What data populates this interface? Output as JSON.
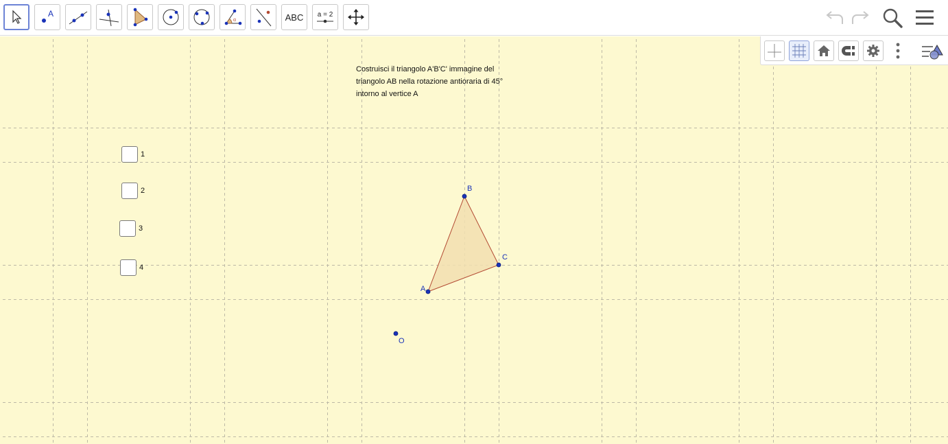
{
  "toolbar": {
    "tools": [
      {
        "name": "move-tool",
        "label": ""
      },
      {
        "name": "point-tool",
        "label": "A"
      },
      {
        "name": "line-tool",
        "label": ""
      },
      {
        "name": "perpendicular-line-tool",
        "label": ""
      },
      {
        "name": "polygon-tool",
        "label": ""
      },
      {
        "name": "circle-center-point-tool",
        "label": ""
      },
      {
        "name": "circle-three-points-tool",
        "label": ""
      },
      {
        "name": "angle-tool",
        "label": ""
      },
      {
        "name": "reflect-about-line-tool",
        "label": ""
      },
      {
        "name": "text-tool",
        "label": "ABC"
      },
      {
        "name": "slider-tool",
        "label": "a = 2"
      },
      {
        "name": "move-graphics-view-tool",
        "label": ""
      }
    ],
    "right_icons": [
      "undo-icon",
      "redo-icon",
      "search-icon",
      "menu-icon"
    ]
  },
  "style_bar": {
    "buttons": [
      "axes-toggle",
      "grid-toggle",
      "standard-view",
      "point-capturing",
      "graphics-settings",
      "more-options",
      "toggle-style-bar"
    ]
  },
  "instructions": {
    "line1": "Costruisci il triangolo A'B'C' immagine del",
    "line2": "triangolo AB nella rotazione antioraria di 45°",
    "line3": "intorno al vertice A"
  },
  "checkboxes": [
    {
      "label": "1"
    },
    {
      "label": "2"
    },
    {
      "label": "3"
    },
    {
      "label": "4"
    }
  ],
  "points": {
    "A": "A",
    "B": "B",
    "C": "C",
    "O": "O"
  },
  "colors": {
    "canvas_bg": "#fdf9d0",
    "point_color": "#1a33b8",
    "triangle_fill": "#f3deb0",
    "triangle_stroke": "#b34a33",
    "active_tool_border": "#6c83d6"
  }
}
